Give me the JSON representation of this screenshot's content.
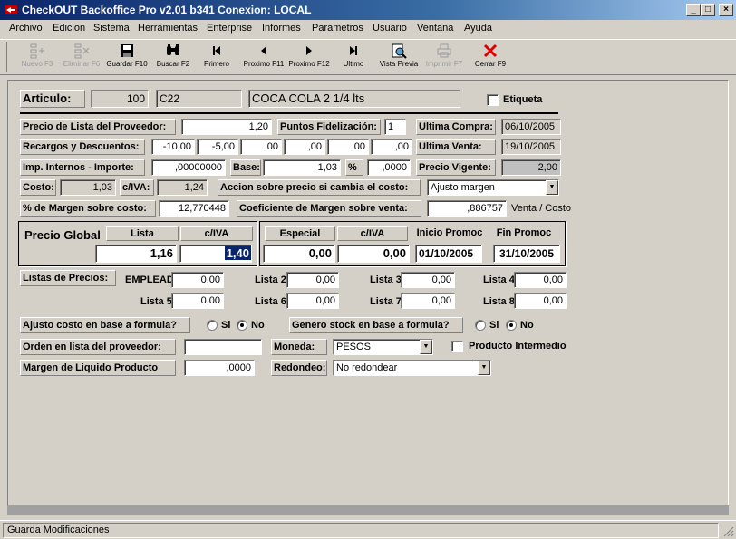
{
  "window": {
    "title": "CheckOUT Backoffice Pro v2.01 b341 Conexion: LOCAL",
    "minimize": "_",
    "restore": "□",
    "close": "×"
  },
  "menu": [
    "Archivo",
    "Edicion",
    "Sistema",
    "Herramientas",
    "Enterprise",
    "Informes",
    "Parametros",
    "Usuario",
    "Ventana",
    "Ayuda"
  ],
  "toolbar": [
    {
      "label": "Nuevo F3",
      "icon": "new-icon",
      "enabled": false
    },
    {
      "label": "Eliminar F6",
      "icon": "delete-icon",
      "enabled": false
    },
    {
      "label": "Guardar F10",
      "icon": "save-icon",
      "enabled": true
    },
    {
      "label": "Buscar F2",
      "icon": "binoculars-icon",
      "enabled": true
    },
    {
      "label": "Primero",
      "icon": "first-icon",
      "enabled": true
    },
    {
      "label": "Proximo F11",
      "icon": "previous-icon",
      "enabled": true
    },
    {
      "label": "Proximo F12",
      "icon": "next-icon",
      "enabled": true
    },
    {
      "label": "Ultimo",
      "icon": "last-icon",
      "enabled": true
    },
    {
      "label": "Vista Previa",
      "icon": "preview-icon",
      "enabled": true
    },
    {
      "label": "Imprimir F7",
      "icon": "print-icon",
      "enabled": false
    },
    {
      "label": "Cerrar F9",
      "icon": "close-x-icon",
      "enabled": true
    }
  ],
  "article": {
    "label": "Articulo:",
    "number": "100",
    "code": "C22",
    "description": "COCA COLA 2 1/4 lts",
    "etiqueta_label": "Etiqueta",
    "etiqueta_checked": false
  },
  "prices": {
    "lista_proveedor_label": "Precio de Lista del Proveedor:",
    "lista_proveedor": "1,20",
    "puntos_label": "Puntos Fidelización:",
    "puntos": "1",
    "ultima_compra_label": "Ultima Compra:",
    "ultima_compra": "06/10/2005",
    "recargos_label": "Recargos y Descuentos:",
    "recargos": [
      "-10,00",
      "-5,00",
      ",00",
      ",00",
      ",00",
      ",00"
    ],
    "ultima_venta_label": "Ultima Venta:",
    "ultima_venta": "19/10/2005",
    "imp_internos_label": "Imp. Internos - Importe:",
    "imp_internos": ",00000000",
    "base_label": "Base:",
    "base": "1,03",
    "pct_label": "%",
    "pct": ",0000",
    "precio_vigente_label": "Precio Vigente:",
    "precio_vigente": "2,00",
    "costo_label": "Costo:",
    "costo": "1,03",
    "civa_label": "c/IVA:",
    "civa": "1,24",
    "accion_label": "Accion sobre precio si cambia el costo:",
    "accion": "Ajusto margen",
    "margen_label": "% de Margen sobre costo:",
    "margen": "12,770448",
    "coef_label": "Coeficiente de Margen sobre venta:",
    "coef": ",886757",
    "coef_suffix": "Venta / Costo"
  },
  "precio_global": {
    "title": "Precio Global",
    "lista_header": "Lista",
    "civa_header": "c/IVA",
    "lista": "1,16",
    "civa": "1,40",
    "especial_header": "Especial",
    "civa2_header": "c/IVA",
    "inicio_header": "Inicio Promoc",
    "fin_header": "Fin Promoc",
    "especial": "0,00",
    "especial_civa": "0,00",
    "inicio": "01/10/2005",
    "fin": "31/10/2005"
  },
  "listas": {
    "title": "Listas de Precios:",
    "items": [
      {
        "label": "EMPLEAD",
        "value": "0,00"
      },
      {
        "label": "Lista 2",
        "value": "0,00"
      },
      {
        "label": "Lista 3",
        "value": "0,00"
      },
      {
        "label": "Lista 4",
        "value": "0,00"
      },
      {
        "label": "Lista 5",
        "value": "0,00"
      },
      {
        "label": "Lista 6",
        "value": "0,00"
      },
      {
        "label": "Lista 7",
        "value": "0,00"
      },
      {
        "label": "Lista 8",
        "value": "0,00"
      }
    ]
  },
  "options": {
    "ajuste_label": "Ajusto costo en base a formula?",
    "genero_label": "Genero stock en base a formula?",
    "si": "Si",
    "no": "No",
    "ajuste_value": "No",
    "genero_value": "No",
    "orden_label": "Orden en lista del proveedor:",
    "orden": "",
    "moneda_label": "Moneda:",
    "moneda": "PESOS",
    "intermedio_label": "Producto Intermedio",
    "intermedio_checked": false,
    "liquido_label": "Margen de Liquido Producto",
    "liquido": ",0000",
    "redondeo_label": "Redondeo:",
    "redondeo": "No redondear"
  },
  "status": "Guarda Modificaciones"
}
